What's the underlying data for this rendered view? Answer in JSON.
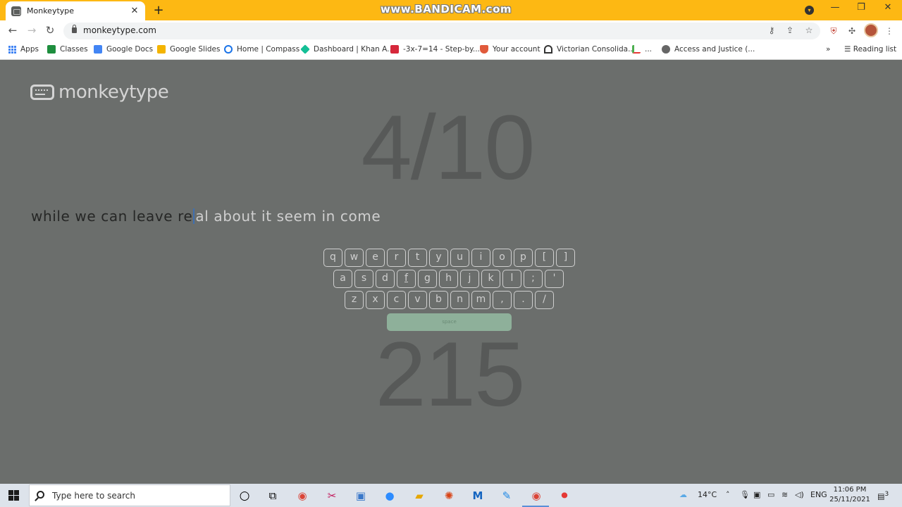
{
  "browser": {
    "tab_title": "Monkeytype",
    "tab_close": "✕",
    "new_tab": "+",
    "recorder_watermark": "www.BANDICAM.com",
    "url": "monkeytype.com",
    "window_controls": {
      "minimize": "—",
      "maximize": "❐",
      "close": "✕"
    }
  },
  "bookmarks": [
    {
      "label": "Apps",
      "icon": "apps-grid-icon"
    },
    {
      "label": "Classes",
      "icon": "classroom-icon",
      "color": "#1e8e3e"
    },
    {
      "label": "Google Docs",
      "icon": "docs-icon",
      "color": "#4285f4"
    },
    {
      "label": "Google Slides",
      "icon": "slides-icon",
      "color": "#f4b400"
    },
    {
      "label": "Home | Compass",
      "icon": "compass-icon",
      "color": "#1a73e8"
    },
    {
      "label": "Dashboard | Khan A...",
      "icon": "khan-icon",
      "color": "#14bf96"
    },
    {
      "label": "-3x-7=14 - Step-by...",
      "icon": "symbolab-icon",
      "color": "#d6283b"
    },
    {
      "label": "Your account",
      "icon": "shield-icon",
      "color": "#e05a3b"
    },
    {
      "label": "Victorian Consolida...",
      "icon": "vic-icon",
      "color": "#333333"
    },
    {
      "label": "...",
      "icon": "list-icon",
      "color": "#4caf50"
    },
    {
      "label": "Access and Justice (...",
      "icon": "globe-icon",
      "color": "#666666"
    }
  ],
  "bookmarks_overflow": "»",
  "reading_list": "Reading list",
  "app": {
    "logo_text": "monkeytype",
    "progress_text": "4/10",
    "typed_words": "while we can leave re",
    "untyped_words": "al about it seem in come",
    "wpm": "215",
    "space_label": "space"
  },
  "keyboard": {
    "row1": [
      "q",
      "w",
      "e",
      "r",
      "t",
      "y",
      "u",
      "i",
      "o",
      "p",
      "[",
      "]"
    ],
    "row2": [
      "a",
      "s",
      "d",
      "f",
      "g",
      "h",
      "j",
      "k",
      "l",
      ";",
      "'"
    ],
    "row3": [
      "z",
      "x",
      "c",
      "v",
      "b",
      "n",
      "m",
      ",",
      ".",
      "/"
    ],
    "home_keys": [
      "f",
      "j"
    ]
  },
  "taskbar": {
    "search_placeholder": "Type here to search",
    "weather": "14°C",
    "language": "ENG",
    "time": "11:06 PM",
    "date": "25/11/2021",
    "notifications": "3"
  }
}
